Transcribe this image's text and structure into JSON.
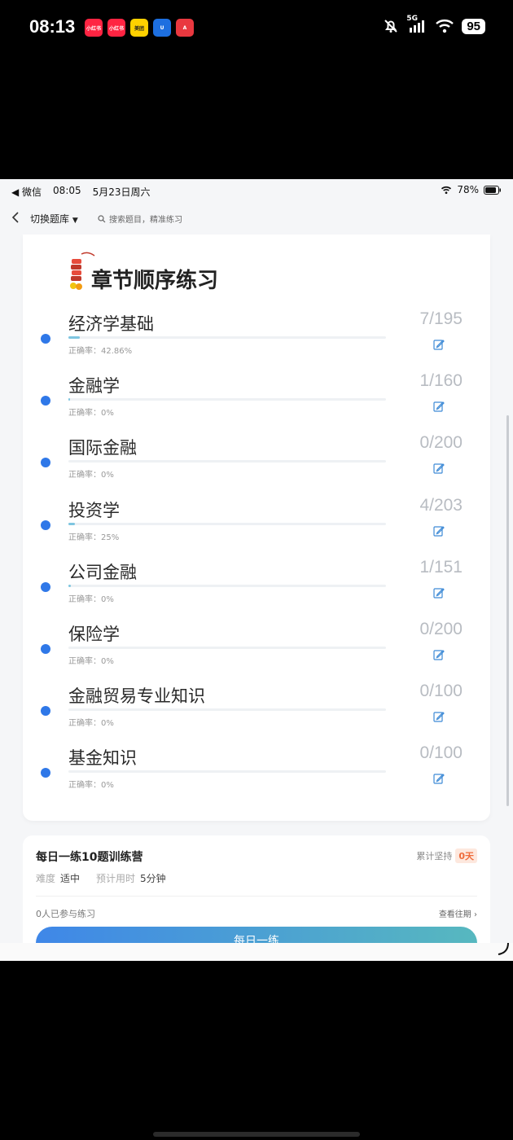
{
  "outer_status": {
    "time": "08:13",
    "app_icons": [
      {
        "label": "小红书",
        "color": "#ff2442"
      },
      {
        "label": "小红书",
        "color": "#ff2442"
      },
      {
        "label": "美团",
        "color": "#ffd100"
      },
      {
        "label": "U",
        "color": "#1d6fe0"
      },
      {
        "label": "A",
        "color": "#e9383f"
      }
    ],
    "network": "5G",
    "battery": "95"
  },
  "inner_status": {
    "back_app": "◀ 微信",
    "time": "08:05",
    "date": "5月23日周六",
    "battery": "78%"
  },
  "nav": {
    "switch_label": "切换题库",
    "search_placeholder": "搜索题目，精准练习"
  },
  "section": {
    "title": "章节顺序练习"
  },
  "chapters": [
    {
      "name": "经济学基础",
      "accuracy": "正确率：42.86%",
      "count": "7/195",
      "progress": 0.036
    },
    {
      "name": "金融学",
      "accuracy": "正确率：0%",
      "count": "1/160",
      "progress": 0.006
    },
    {
      "name": "国际金融",
      "accuracy": "正确率：0%",
      "count": "0/200",
      "progress": 0
    },
    {
      "name": "投资学",
      "accuracy": "正确率：25%",
      "count": "4/203",
      "progress": 0.02
    },
    {
      "name": "公司金融",
      "accuracy": "正确率：0%",
      "count": "1/151",
      "progress": 0.007
    },
    {
      "name": "保险学",
      "accuracy": "正确率：0%",
      "count": "0/200",
      "progress": 0
    },
    {
      "name": "金融贸易专业知识",
      "accuracy": "正确率：0%",
      "count": "0/100",
      "progress": 0
    },
    {
      "name": "基金知识",
      "accuracy": "正确率：0%",
      "count": "0/100",
      "progress": 0
    }
  ],
  "daily": {
    "title": "每日一练10题训练营",
    "streak_label": "累计坚持",
    "streak_value": "0天",
    "difficulty_label": "难度",
    "difficulty_value": "适中",
    "time_label": "预计用时",
    "time_value": "5分钟",
    "participants": "0人已参与练习",
    "history": "查看往期 ›",
    "button": "每日一练"
  },
  "colors": {
    "accent": "#2f78e8",
    "progress_fill": "#7ec5e0",
    "streak": "#ef6b3a"
  }
}
